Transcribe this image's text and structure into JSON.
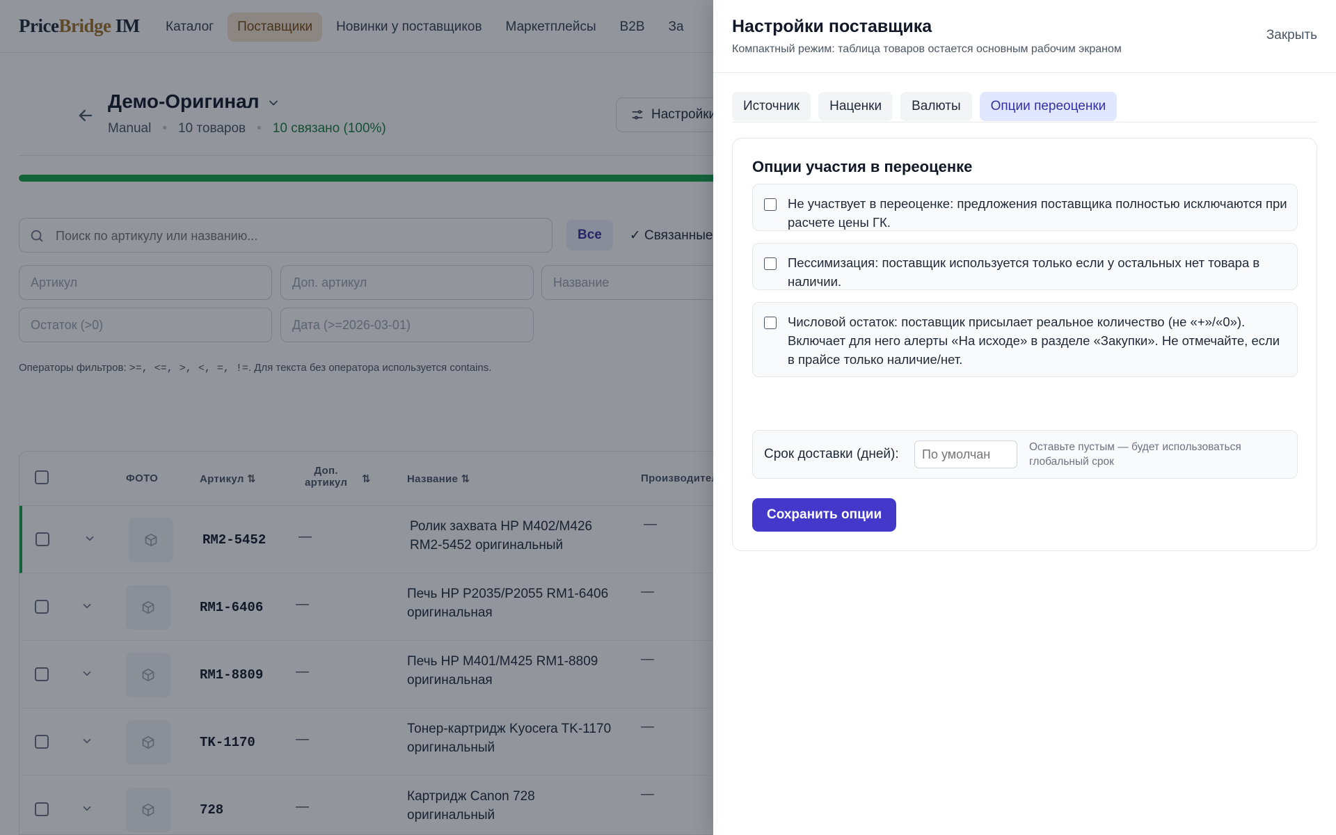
{
  "app": {
    "logo_a": "Price",
    "logo_b": "Bridge",
    "logo_c": " IM",
    "nav": [
      "Каталог",
      "Поставщики",
      "Новинки у поставщиков",
      "Маркетплейсы",
      "B2B",
      "За"
    ],
    "active_nav": 1
  },
  "supplier": {
    "title": "Демо-Оригинал",
    "type": "Manual",
    "items_count": "10 товаров",
    "linked": "10 связано (100%)",
    "linked_progress": 1.0,
    "settings_label": "Настройки"
  },
  "search": {
    "placeholder": "Поиск по артикулу или названию..."
  },
  "segments": [
    "Все",
    "✓ Связанные"
  ],
  "filters": {
    "article": "Артикул",
    "extra_article": "Доп. артикул",
    "name": "Название",
    "stock": "Остаток (>0)",
    "date": "Дата (>=2026-03-01)"
  },
  "ops_hint": {
    "prefix": "Операторы фильтров: ",
    "ops": ">=,  <=,  >,  <,  =,  !=",
    "suffix": ". Для текста без оператора используется contains."
  },
  "table": {
    "headers": {
      "photo": "ФОТО",
      "article": "Артикул ⇅",
      "extra_article_1": "Доп.",
      "extra_article_2": "артикул",
      "sort_icon": "⇅",
      "name": "Название ⇅",
      "manufacturer": "Производитель"
    },
    "rows": [
      {
        "sku": "RM2-5452",
        "extra": "—",
        "name": "Ролик захвата HP M402/M426 RM2-5452 оригинальный",
        "manufacturer": "—"
      },
      {
        "sku": "RM1-6406",
        "extra": "—",
        "name": "Печь HP P2035/P2055 RM1-6406 оригинальная",
        "manufacturer": "—"
      },
      {
        "sku": "RM1-8809",
        "extra": "—",
        "name": "Печь HP M401/M425 RM1-8809 оригинальная",
        "manufacturer": "—"
      },
      {
        "sku": "TK-1170",
        "extra": "—",
        "name": "Тонер-картридж Kyocera TK-1170 оригинальный",
        "manufacturer": "—"
      },
      {
        "sku": "728",
        "extra": "—",
        "name": "Картридж Canon 728 оригинальный",
        "manufacturer": "—"
      }
    ]
  },
  "drawer": {
    "title": "Настройки поставщика",
    "subtitle": "Компактный режим: таблица товаров остается основным рабочим экраном",
    "close_label": "Закрыть",
    "tabs": [
      "Источник",
      "Наценки",
      "Валюты",
      "Опции переоценки"
    ],
    "active_tab": 3,
    "section_title": "Опции участия в переоценке",
    "options": [
      {
        "text": "Не участвует в переоценке: предложения поставщика полностью исключаются при расчете цены ГК.",
        "checked": false
      },
      {
        "text": "Пессимизация: поставщик используется только если у остальных нет товара в наличии.",
        "checked": false
      },
      {
        "text": "Числовой остаток: поставщик присылает реальное количество (не «+»/«0»). Включает для него алерты «На исходе» в разделе «Закупки». Не отмечайте, если в прайсе только наличие/нет.",
        "checked": false
      }
    ],
    "delivery_label": "Срок доставки (дней):",
    "delivery_placeholder": "По умолчан",
    "delivery_hint": "Оставьте пустым — будет использоваться глобальный срок",
    "save_label": "Сохранить опции"
  },
  "colors": {
    "accent": "#4338ca",
    "active_tab_bg": "#e0e7ff",
    "success": "#16a34a",
    "nav_active_bg": "#f3e4cf"
  }
}
